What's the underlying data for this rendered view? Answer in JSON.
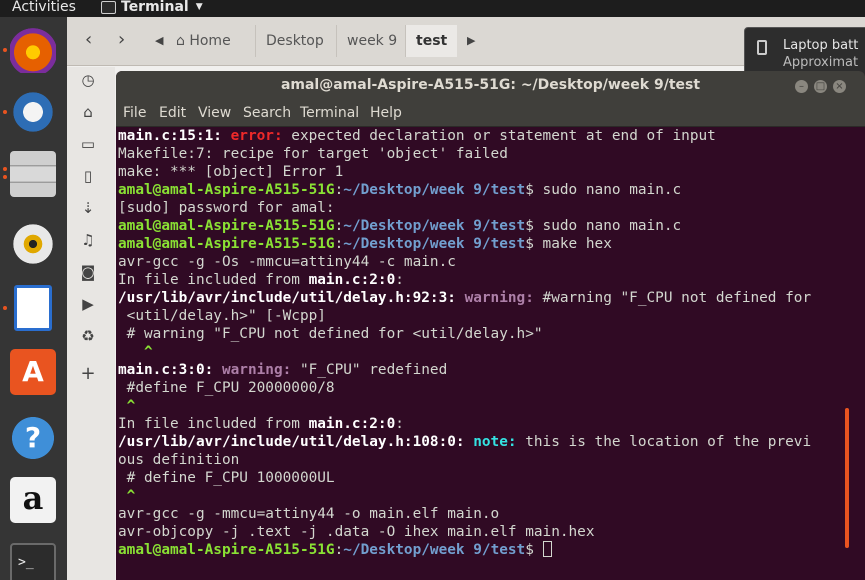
{
  "topbar": {
    "activities": "Activities",
    "app_name": "Terminal"
  },
  "dock": {
    "items": [
      {
        "name": "firefox",
        "color": "#e66000"
      },
      {
        "name": "thunderbird",
        "color": "#2d6db5"
      },
      {
        "name": "files",
        "color": "#bdbdbd"
      },
      {
        "name": "rhythmbox",
        "color": "#d8d8d8"
      },
      {
        "name": "libreoffice-writer",
        "color": "#2a6ecf"
      },
      {
        "name": "ubuntu-software",
        "color": "#e95420"
      },
      {
        "name": "help",
        "color": "#3f8fd8"
      },
      {
        "name": "amazon",
        "color": "#f2f2f2"
      },
      {
        "name": "terminal",
        "color": "#2c2c2c"
      }
    ]
  },
  "files": {
    "breadcrumbs": [
      "Home",
      "Desktop",
      "week 9",
      "test"
    ]
  },
  "notification": {
    "title": "Laptop batt",
    "subtitle": "Approximat"
  },
  "terminal": {
    "title": "amal@amal-Aspire-A515-51G: ~/Desktop/week 9/test",
    "menu": [
      "File",
      "Edit",
      "View",
      "Search",
      "Terminal",
      "Help"
    ],
    "prompt_user": "amal@amal-Aspire-A515-51G",
    "prompt_path": "~/Desktop/week 9/test",
    "lines": [
      [
        {
          "c": "b",
          "t": "main.c:15:1: "
        },
        {
          "c": "err",
          "t": "error: "
        },
        {
          "t": "expected declaration or statement at end of input"
        }
      ],
      [
        {
          "t": "Makefile:7: recipe for target 'object' failed"
        }
      ],
      [
        {
          "t": "make: *** [object] Error 1"
        }
      ],
      [
        {
          "c": "u",
          "t": "amal@amal-Aspire-A515-51G"
        },
        {
          "t": ":"
        },
        {
          "c": "pth",
          "t": "~/Desktop/week 9/test"
        },
        {
          "t": "$ sudo nano main.c"
        }
      ],
      [
        {
          "t": "[sudo] password for amal:"
        }
      ],
      [
        {
          "c": "u",
          "t": "amal@amal-Aspire-A515-51G"
        },
        {
          "t": ":"
        },
        {
          "c": "pth",
          "t": "~/Desktop/week 9/test"
        },
        {
          "t": "$ sudo nano main.c"
        }
      ],
      [
        {
          "c": "u",
          "t": "amal@amal-Aspire-A515-51G"
        },
        {
          "t": ":"
        },
        {
          "c": "pth",
          "t": "~/Desktop/week 9/test"
        },
        {
          "t": "$ make hex"
        }
      ],
      [
        {
          "t": "avr-gcc -g -Os -mmcu=attiny44 -c main.c"
        }
      ],
      [
        {
          "t": "In file included from "
        },
        {
          "c": "b",
          "t": "main.c:2:0"
        },
        {
          "t": ":"
        }
      ],
      [
        {
          "c": "b",
          "t": "/usr/lib/avr/include/util/delay.h:92:3: "
        },
        {
          "c": "warn",
          "t": "warning: "
        },
        {
          "t": "#warning \"F_CPU not defined for"
        }
      ],
      [
        {
          "t": " <util/delay.h>\" [-Wcpp]"
        }
      ],
      [
        {
          "t": " # warning \"F_CPU not defined for <util/delay.h>\""
        }
      ],
      [
        {
          "c": "caret",
          "t": "   ^"
        }
      ],
      [
        {
          "c": "b",
          "t": "main.c:3:0: "
        },
        {
          "c": "warn",
          "t": "warning: "
        },
        {
          "t": "\"F_CPU\" redefined"
        }
      ],
      [
        {
          "t": " #define F_CPU 20000000/8"
        }
      ],
      [
        {
          "c": "caret",
          "t": " ^"
        }
      ],
      [
        {
          "t": "In file included from "
        },
        {
          "c": "b",
          "t": "main.c:2:0"
        },
        {
          "t": ":"
        }
      ],
      [
        {
          "c": "b",
          "t": "/usr/lib/avr/include/util/delay.h:108:0: "
        },
        {
          "c": "note",
          "t": "note: "
        },
        {
          "t": "this is the location of the previ"
        }
      ],
      [
        {
          "t": "ous definition"
        }
      ],
      [
        {
          "t": " # define F_CPU 1000000UL"
        }
      ],
      [
        {
          "c": "caret",
          "t": " ^"
        }
      ],
      [
        {
          "t": "avr-gcc -g -mmcu=attiny44 -o main.elf main.o"
        }
      ],
      [
        {
          "t": "avr-objcopy -j .text -j .data -O ihex main.elf main.hex"
        }
      ],
      [
        {
          "c": "u",
          "t": "amal@amal-Aspire-A515-51G"
        },
        {
          "t": ":"
        },
        {
          "c": "pth",
          "t": "~/Desktop/week 9/test"
        },
        {
          "t": "$ "
        }
      ]
    ]
  }
}
